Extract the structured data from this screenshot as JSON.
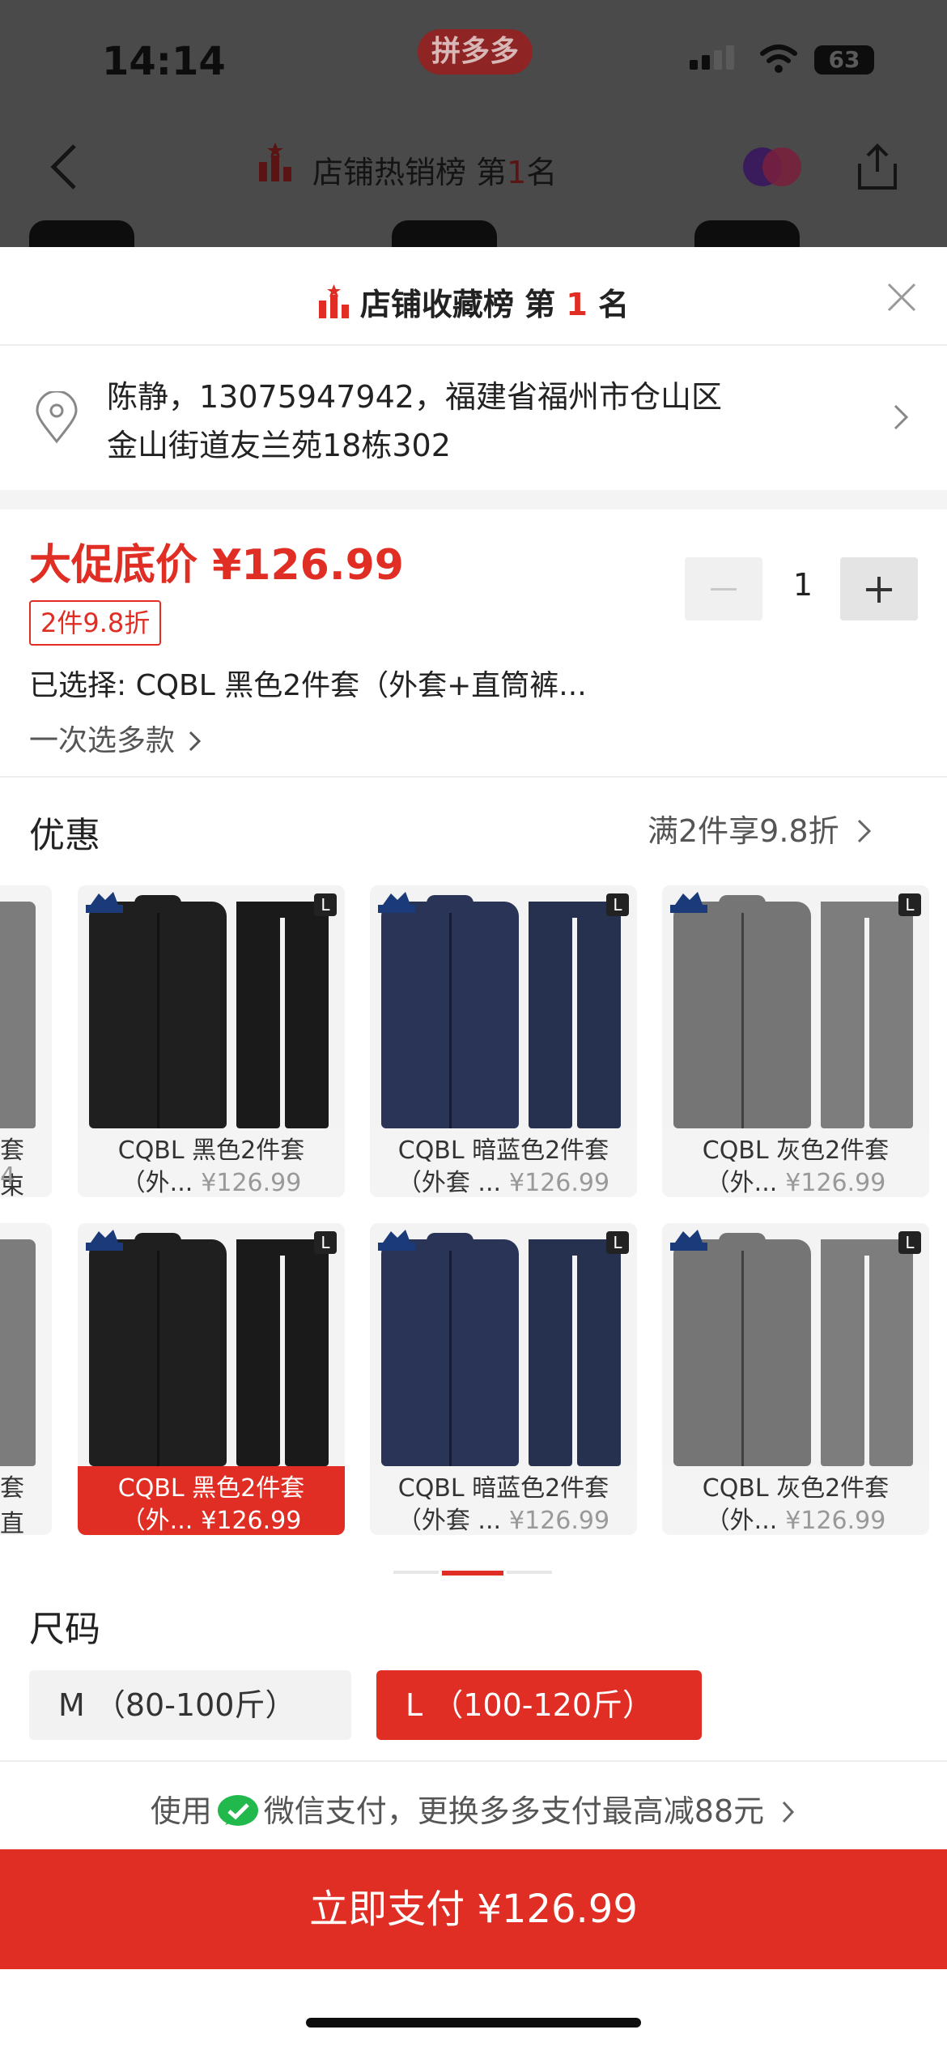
{
  "status_bar": {
    "time": "14:14",
    "app_badge": "拼多多",
    "battery": "63"
  },
  "background_nav": {
    "title_prefix": "店铺热销榜 第",
    "rank": "1",
    "title_suffix": "名"
  },
  "sheet": {
    "rank_prefix": "店铺收藏榜 第",
    "rank_number": "1",
    "rank_suffix": "名",
    "address_line1": "陈静，13075947942，福建省福州市仓山区",
    "address_line2": "金山街道友兰苑18栋302",
    "promo_price": "大促底价 ¥126.99",
    "discount_tag": "2件9.8折",
    "selected_text": "已选择: CQBL 黑色2件套（外套+直筒裤...",
    "multi_select": "一次选多款",
    "quantity": "1",
    "offer_title": "优惠",
    "offer_text": "满2件享9.8折",
    "size_title": "尺码",
    "sizes": [
      {
        "label": "M （80-100斤）",
        "selected": false
      },
      {
        "label": "L （100-120斤）",
        "selected": true
      }
    ],
    "pay_tip_prefix": "使用",
    "pay_tip_suffix": "微信支付，更换多多支付最高减88元",
    "pay_button": "立即支付 ¥126.99"
  },
  "products_row1": {
    "partial": {
      "cap1": "套 束",
      "cap2": "4"
    },
    "items": [
      {
        "cap1": "CQBL 黑色2件套",
        "cap2": "（外...",
        "price": "¥126.99",
        "color": "#1f1f1f",
        "pant": "#1a1a1a"
      },
      {
        "cap1": "CQBL 暗蓝色2件套",
        "cap2": "（外套 ...",
        "price": "¥126.99",
        "color": "#2a3457",
        "pant": "#26304f"
      },
      {
        "cap1": "CQBL 灰色2件套",
        "cap2": "（外...",
        "price": "¥126.99",
        "color": "#757575",
        "pant": "#7d7d7d"
      }
    ]
  },
  "products_row2": {
    "partial": {
      "cap1": "套 直",
      "cap2": ""
    },
    "items": [
      {
        "cap1": "CQBL 黑色2件套",
        "cap2": "（外...",
        "price": "¥126.99",
        "color": "#1f1f1f",
        "pant": "#1a1a1a",
        "selected": true
      },
      {
        "cap1": "CQBL 暗蓝色2件套",
        "cap2": "（外套 ...",
        "price": "¥126.99",
        "color": "#2a3457",
        "pant": "#26304f"
      },
      {
        "cap1": "CQBL 灰色2件套",
        "cap2": "（外...",
        "price": "¥126.99",
        "color": "#757575",
        "pant": "#7d7d7d"
      }
    ]
  },
  "icons": [
    "back-icon",
    "rank-icon",
    "share-icon",
    "close-icon",
    "location-pin-icon",
    "chevron-right-icon",
    "wechat-pay-icon"
  ],
  "colors": {
    "accent": "#e02e24",
    "wechat": "#21b94c"
  }
}
